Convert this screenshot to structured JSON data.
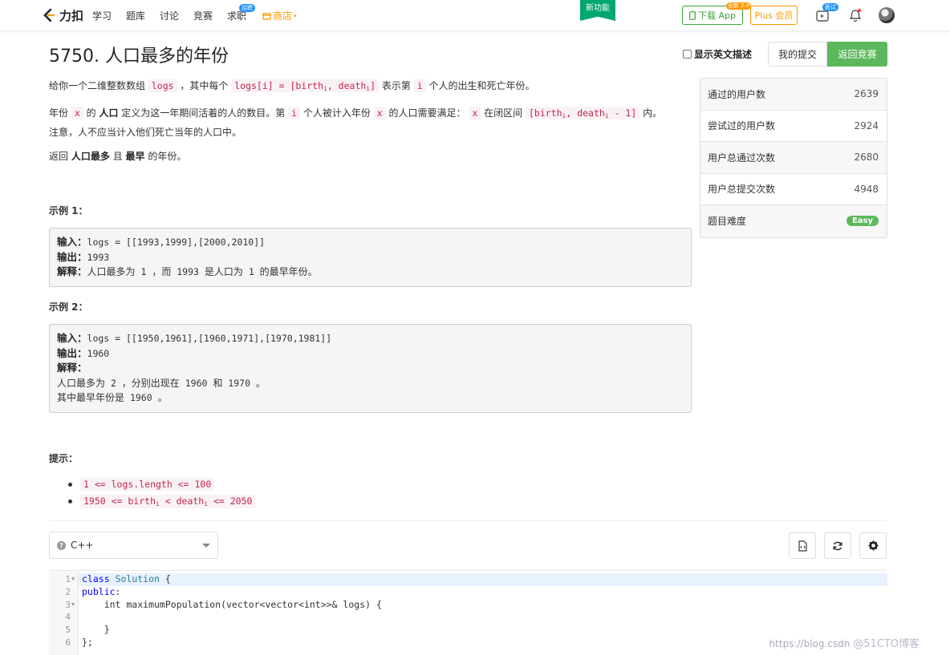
{
  "nav": {
    "logo": "力扣",
    "items": [
      "学习",
      "题库",
      "讨论",
      "竞赛",
      "求职"
    ],
    "jobs_badge": "招聘",
    "shop": "商店",
    "new_feature": "新功能",
    "download": "下载 App",
    "download_badge": "全新 2.0",
    "plus": "Plus 会员",
    "interview_badge": "面试"
  },
  "problem": {
    "title": "5750. 人口最多的年份",
    "show_english": "显示英文描述",
    "my_submissions": "我的提交",
    "back_to_contest": "返回竞赛"
  },
  "description": {
    "p1_a": "给你一个二维整数数组",
    "p1_code1": "logs",
    "p1_b": "，其中每个",
    "p1_code2a": "logs[i] = [birth",
    "p1_sub1": "i",
    "p1_code2b": ", death",
    "p1_sub2": "i",
    "p1_code2c": "]",
    "p1_c": "表示第",
    "p1_code3": "i",
    "p1_d": "个人的出生和死亡年份。",
    "p2_a": "年份",
    "p2_code1": "x",
    "p2_b": "的",
    "p2_bold": "人口",
    "p2_c": "定义为这一年期间活着的人的数目。第",
    "p2_code2": "i",
    "p2_d": "个人被计入年份",
    "p2_code3": "x",
    "p2_e": "的人口需要满足：",
    "p2_code4": "x",
    "p2_f": "在闭区间",
    "p2_code5a": "[birth",
    "p2_sub1": "i",
    "p2_code5b": ", death",
    "p2_sub2": "i",
    "p2_code5c": " - 1]",
    "p2_g": "内。",
    "p2_line2": "注意，人不应当计入他们死亡当年的人口中。",
    "p3_a": "返回",
    "p3_bold1": "人口最多",
    "p3_b": "且",
    "p3_bold2": "最早",
    "p3_c": "的年份。"
  },
  "example1": {
    "title": "示例 1：",
    "input_label": "输入：",
    "input": "logs = [[1993,1999],[2000,2010]]",
    "output_label": "输出：",
    "output": "1993",
    "explain_label": "解释：",
    "explain_a": "人口最多为",
    "explain_n1": " 1 ",
    "explain_b": "，而",
    "explain_n2": " 1993 ",
    "explain_c": "是人口为",
    "explain_n3": " 1 ",
    "explain_d": "的最早年份。"
  },
  "example2": {
    "title": "示例 2：",
    "input_label": "输入：",
    "input": "logs = [[1950,1961],[1960,1971],[1970,1981]]",
    "output_label": "输出：",
    "output": "1960",
    "explain_label": "解释：",
    "line1_a": "人口最多为",
    "line1_n1": " 2 ",
    "line1_b": "，分别出现在",
    "line1_n2": " 1960 ",
    "line1_c": "和",
    "line1_n3": " 1970 ",
    "line1_d": "。",
    "line2_a": "其中最早年份是",
    "line2_n": " 1960 ",
    "line2_b": "。"
  },
  "hints": {
    "title": "提示：",
    "h1": "1 <= logs.length <= 100",
    "h2_a": "1950 <= birth",
    "h2_sub1": "i",
    "h2_b": " < death",
    "h2_sub2": "i",
    "h2_c": " <= 2050"
  },
  "stats": [
    {
      "label": "通过的用户数",
      "value": "2639"
    },
    {
      "label": "尝试过的用户数",
      "value": "2924"
    },
    {
      "label": "用户总通过次数",
      "value": "2680"
    },
    {
      "label": "用户总提交次数",
      "value": "4948"
    },
    {
      "label": "题目难度",
      "value": "Easy"
    }
  ],
  "editor": {
    "language": "C++",
    "line_numbers": [
      "1",
      "2",
      "3",
      "4",
      "5",
      "6"
    ],
    "lines": [
      [
        "class",
        " ",
        "Solution",
        " {"
      ],
      [
        "public",
        ":"
      ],
      [
        "    int maximumPopulation(vector<vector<int>>& logs) {"
      ],
      [
        ""
      ],
      [
        "    }"
      ],
      [
        "};"
      ]
    ]
  },
  "watermark": {
    "url": "https://blog.csdn",
    "brand": "@51CTO博客"
  },
  "colors": {
    "accent_green": "#5cb85c",
    "code_red": "#c7254e",
    "shop_orange": "#ff9900",
    "new_feature_green": "#00a76f"
  }
}
